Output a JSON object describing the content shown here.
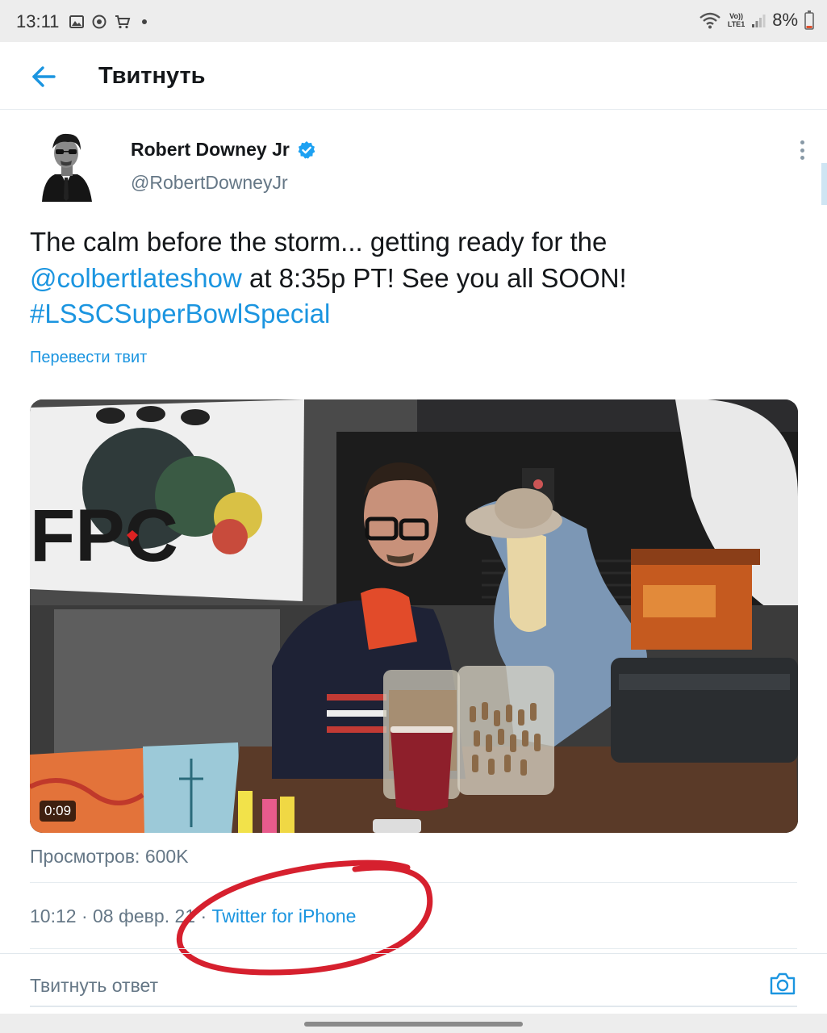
{
  "status_bar": {
    "time": "13:11",
    "lte_line1": "Vo))",
    "lte_line2": "LTE1",
    "battery": "8%",
    "icons": [
      "gallery-icon",
      "circle-app-icon",
      "cart-icon",
      "dot-icon",
      "wifi-icon",
      "signal-icon",
      "battery-icon"
    ]
  },
  "header": {
    "title": "Твитнуть",
    "back_icon": "arrow-left-icon"
  },
  "tweet": {
    "author_name": "Robert Downey Jr",
    "handle": "@RobertDowneyJr",
    "verified": true,
    "text_part1": "The calm before the storm... getting ready for the ",
    "mention": "@colbertlateshow",
    "text_part2": " at 8:35p PT! See you all SOON! ",
    "hashtag": "#LSSCSuperBowlSpecial",
    "translate_label": "Перевести твит",
    "video_duration": "0:09",
    "views": "Просмотров: 600K",
    "timestamp": "10:12 · 08 февр. 21 · ",
    "source": "Twitter for iPhone"
  },
  "reply": {
    "placeholder": "Твитнуть ответ",
    "camera_icon": "camera-icon"
  },
  "colors": {
    "accent": "#1b95e0",
    "annotation": "#d6202e",
    "secondary_text": "#657786"
  }
}
